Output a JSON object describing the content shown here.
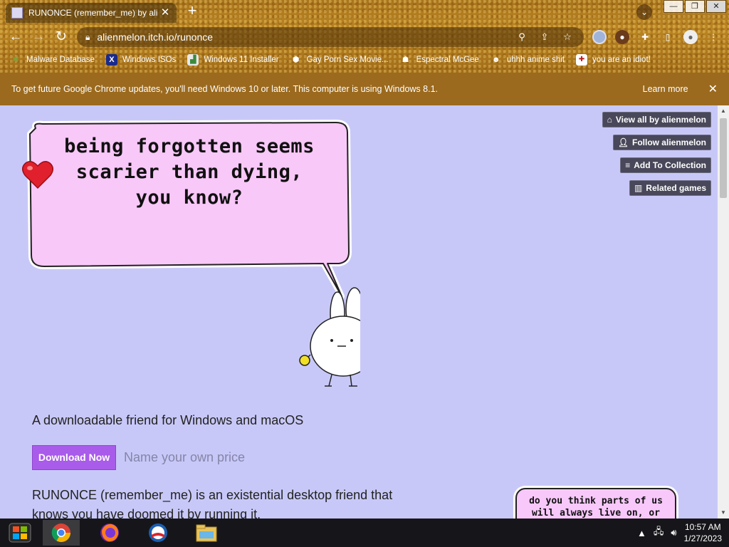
{
  "browser": {
    "tab_title": "RUNONCE (remember_me) by ali",
    "tab_close": "✕",
    "new_tab": "+",
    "url": "alienmelon.itch.io/runonce",
    "window_controls": [
      "—",
      "❐",
      "✕"
    ]
  },
  "bookmarks": [
    {
      "label": "Malware Database",
      "icon": "bug-icon"
    },
    {
      "label": "Windows ISOs",
      "icon": "x-icon"
    },
    {
      "label": "Windows 11 Installer",
      "icon": "image-icon"
    },
    {
      "label": "Gay Porn Sex Movie...",
      "icon": "cube-icon"
    },
    {
      "label": "Espectral McGee",
      "icon": "ghost-icon"
    },
    {
      "label": "uhhh anime shit",
      "icon": "face-icon"
    },
    {
      "label": "you are an idiot!",
      "icon": "flag-icon"
    }
  ],
  "infobar": {
    "message": "To get future Google Chrome updates, you'll need Windows 10 or later. This computer is using Windows 8.1.",
    "learn_more": "Learn more",
    "close": "✕"
  },
  "side_buttons": [
    {
      "label": "View all by alienmelon",
      "icon": "storefront-icon"
    },
    {
      "label": "Follow alienmelon",
      "icon": "user-plus-icon"
    },
    {
      "label": "Add To Collection",
      "icon": "list-add-icon"
    },
    {
      "label": "Related games",
      "icon": "map-icon"
    }
  ],
  "hero": {
    "bubble_text": "being forgotten seems scarier than dying, you know?"
  },
  "game": {
    "tagline": "A downloadable friend for Windows and macOS",
    "download_label": "Download Now",
    "price_label": "Name your own price",
    "description": "RUNONCE (remember_me) is an existential desktop friend that knows you have doomed it by running it.",
    "side_bubble": "do you think parts of us will always live on, or does it all"
  },
  "taskbar": {
    "time": "10:57 AM",
    "date": "1/27/2023"
  }
}
